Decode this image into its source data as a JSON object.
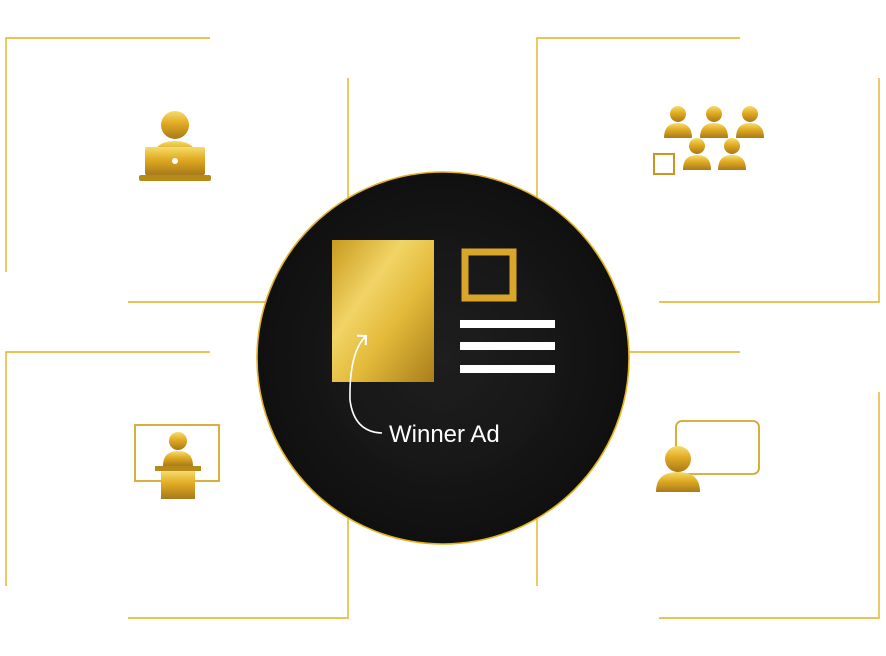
{
  "colors": {
    "gold": "#e3b21f",
    "gold_dark": "#a47a18",
    "gold_light": "#f4df84",
    "circle_fill": "#161616",
    "white": "#ffffff",
    "background": "#ffffff"
  },
  "center": {
    "caption": "Winner Ad"
  },
  "icons": {
    "top_left": "person-laptop-icon",
    "top_right": "audience-group-icon",
    "bottom_left": "speaker-podium-icon",
    "bottom_right": "presenter-board-icon",
    "ad_image": "ad-image-placeholder-icon",
    "ad_text": "ad-text-lines-icon",
    "ad_logo": "ad-square-frame-icon",
    "arrow": "curved-arrow-icon"
  }
}
